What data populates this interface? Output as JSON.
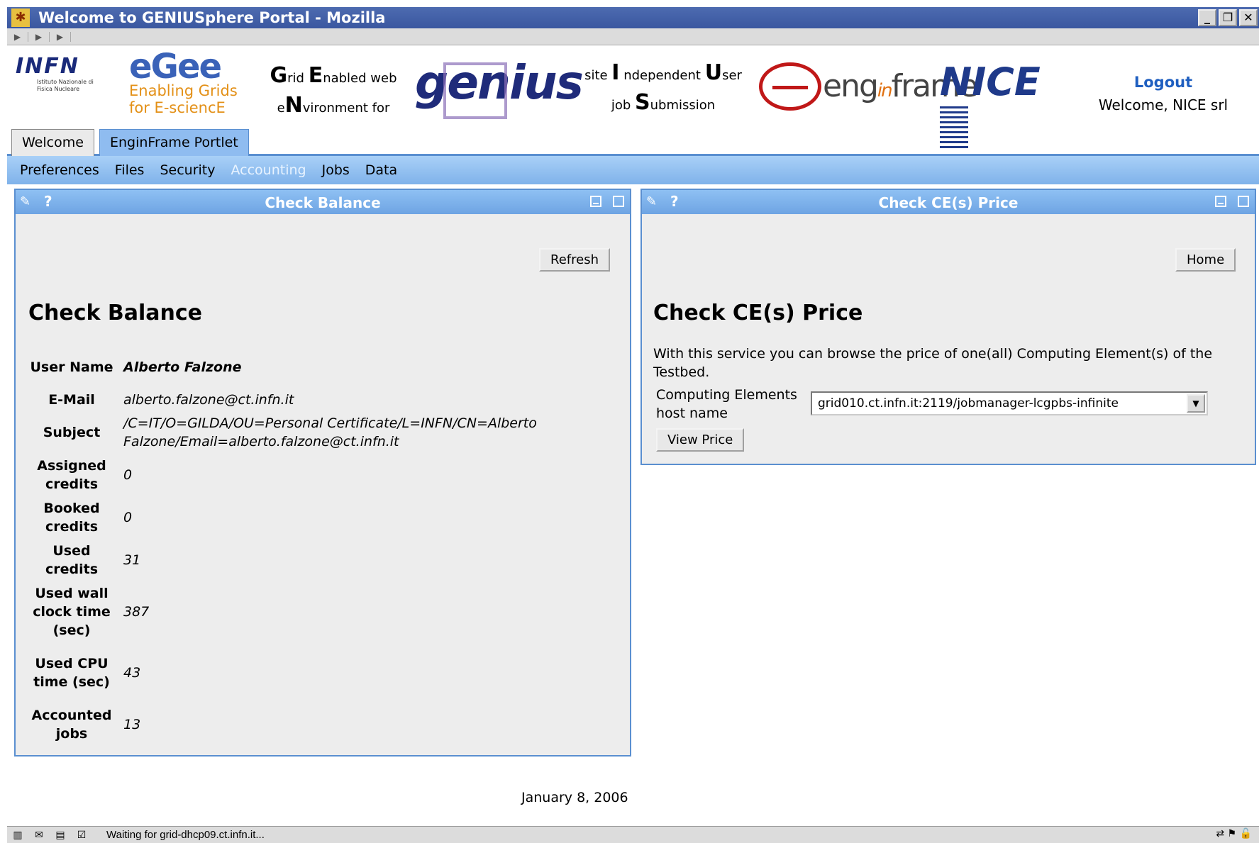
{
  "window": {
    "title": "Welcome to GENIUSphere Portal - Mozilla"
  },
  "header": {
    "infn_text": "INFN",
    "infn_sub": "Istituto Nazionale di Fisica Nucleare",
    "egee_logo": "eGee",
    "egee_line1": "Enabling Grids",
    "egee_line2": "for E-sciencE",
    "genv_line1_a": "G",
    "genv_line1_b": "rid ",
    "genv_line1_c": "E",
    "genv_line1_d": "nabled web",
    "genv_line2_a": "e",
    "genv_line2_b": "N",
    "genv_line2_c": "vironment for",
    "genius_logo": "genius",
    "site_line1_a": "site ",
    "site_line1_b": "I",
    "site_line1_c": " ndependent ",
    "site_line1_d": "U",
    "site_line1_e": "ser",
    "site_line2_a": "job ",
    "site_line2_b": "S",
    "site_line2_c": "ubmission",
    "enginframe_a": "eng",
    "enginframe_b": "in",
    "enginframe_c": "frame",
    "nice_logo": "NICE",
    "logout_label": "Logout",
    "welcome_text": "Welcome, NICE srl"
  },
  "tabs": [
    {
      "label": "Welcome"
    },
    {
      "label": "EnginFrame Portlet"
    }
  ],
  "subnav": [
    "Preferences",
    "Files",
    "Security",
    "Accounting",
    "Jobs",
    "Data"
  ],
  "balance": {
    "portlet_title": "Check Balance",
    "refresh_label": "Refresh",
    "heading": "Check Balance",
    "rows": [
      {
        "label": "User Name",
        "value": "Alberto Falzone"
      },
      {
        "label": "E-Mail",
        "value": "alberto.falzone@ct.infn.it"
      },
      {
        "label": "Subject",
        "value": "/C=IT/O=GILDA/OU=Personal Certificate/L=INFN/CN=Alberto Falzone/Email=alberto.falzone@ct.infn.it"
      },
      {
        "label": "Assigned credits",
        "value": "0"
      },
      {
        "label": "Booked credits",
        "value": "0"
      },
      {
        "label": "Used credits",
        "value": "31"
      },
      {
        "label": "Used wall clock time (sec)",
        "value": "387"
      },
      {
        "label": "Used CPU time (sec)",
        "value": "43"
      },
      {
        "label": "Accounted jobs",
        "value": "13"
      }
    ]
  },
  "price": {
    "portlet_title": "Check CE(s) Price",
    "home_label": "Home",
    "heading": "Check CE(s) Price",
    "description": "With this service you can browse the price of one(all) Computing Element(s) of the Testbed.",
    "ce_label": "Computing Elements host name",
    "ce_value": "grid010.ct.infn.it:2119/jobmanager-lcgpbs-infinite",
    "view_price_label": "View Price"
  },
  "footer": {
    "date": "January 8, 2006"
  },
  "statusbar": {
    "text": "Waiting for grid-dhcp09.ct.infn.it..."
  }
}
